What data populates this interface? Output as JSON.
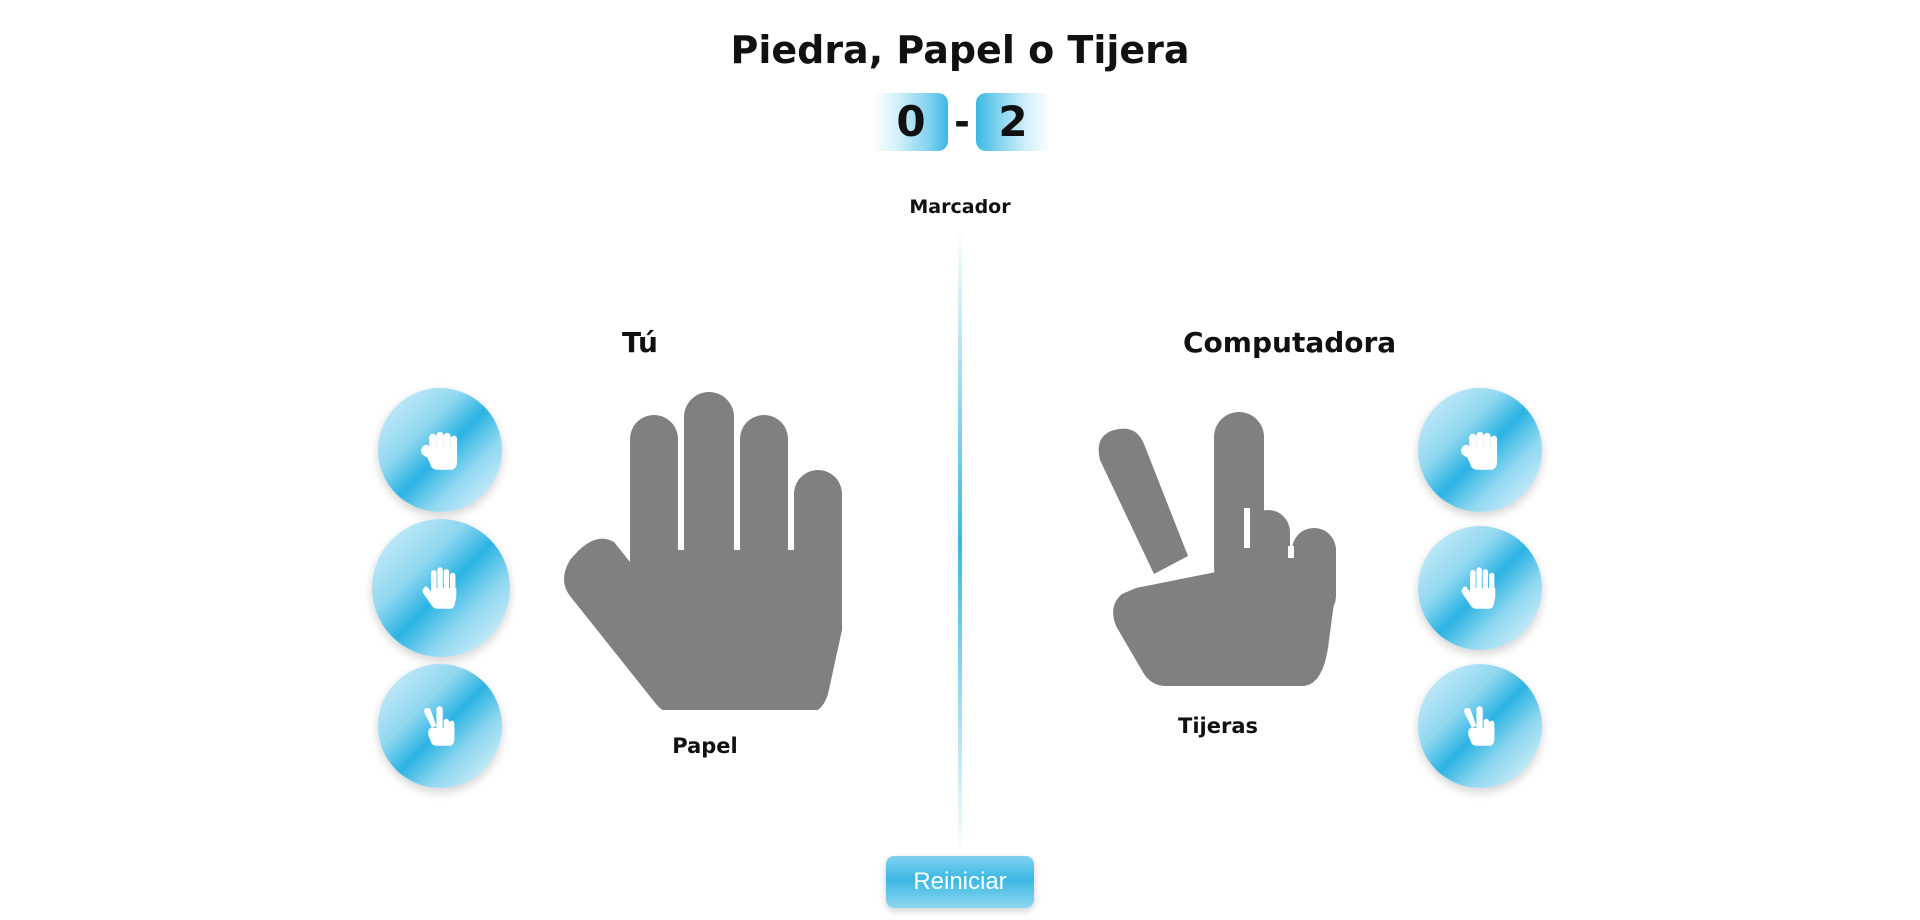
{
  "game": {
    "title": "Piedra, Papel o Tijera",
    "score": {
      "player": "0",
      "separator": "-",
      "computer": "2",
      "label": "Marcador"
    }
  },
  "player": {
    "label": "Tú",
    "selection": "Papel",
    "selection_icon": "paper-hand-icon",
    "options": [
      {
        "icon": "rock-hand-icon"
      },
      {
        "icon": "paper-hand-icon"
      },
      {
        "icon": "scissors-hand-icon"
      }
    ]
  },
  "computer": {
    "label": "Computadora",
    "selection": "Tijeras",
    "selection_icon": "scissors-hand-icon",
    "options": [
      {
        "icon": "rock-hand-icon"
      },
      {
        "icon": "paper-hand-icon"
      },
      {
        "icon": "scissors-hand-icon"
      }
    ]
  },
  "controls": {
    "reset_label": "Reiniciar"
  },
  "colors": {
    "accent": "#3bb8e4",
    "hand_gray": "#808080",
    "icon_white": "#ffffff"
  }
}
